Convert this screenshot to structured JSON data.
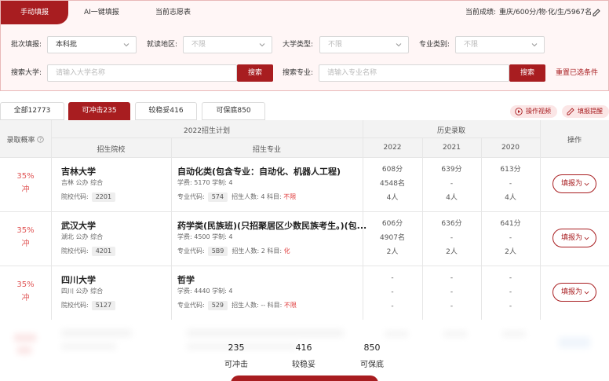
{
  "header": {
    "tabs": [
      "手动填报",
      "AI一键填报",
      "当前志愿表"
    ],
    "score_label": "当前成绩:",
    "score_value": "重庆/600分/物·化/生/5967名"
  },
  "filters": {
    "batch_label": "批次填报:",
    "batch_value": "本科批",
    "region_label": "就读地区:",
    "region_value": "不限",
    "type_label": "大学类型:",
    "type_value": "不限",
    "major_cat_label": "专业类别:",
    "major_cat_value": "不限",
    "search_uni_label": "搜索大学:",
    "search_uni_placeholder": "请输入大学名称",
    "search_btn": "搜索",
    "search_major_label": "搜索专业:",
    "search_major_placeholder": "请输入专业名称",
    "search_btn2": "搜索",
    "reset": "重置已选条件"
  },
  "category_tabs": [
    "全部12773",
    "可冲击235",
    "较稳妥416",
    "可保底850"
  ],
  "actions": {
    "video": "操作视频",
    "tips": "填报提醒"
  },
  "table_header": {
    "prob": "录取概率",
    "plan": "2022招生计划",
    "history": "历史录取",
    "action": "操作",
    "school": "招生院校",
    "major": "招生专业",
    "y2022": "2022",
    "y2021": "2021",
    "y2020": "2020"
  },
  "rows": [
    {
      "prob": "35%",
      "tag": "冲",
      "uni": "吉林大学",
      "uni_meta": "吉林  公办  综合",
      "code_label": "院校代码:",
      "code": "2201",
      "major": "自动化类(包含专业：自动化、机器人工程)",
      "fee": "学费: 5170  学制: 4",
      "mcode_label": "专业代码:",
      "mcode": "574",
      "plan": "招生人数: 4  科目:",
      "subject": "不限",
      "h2022": [
        "608分",
        "4548名",
        "4人"
      ],
      "h2021": [
        "639分",
        "-",
        "4人"
      ],
      "h2020": [
        "613分",
        "-",
        "4人"
      ],
      "btn": "填报为"
    },
    {
      "prob": "35%",
      "tag": "冲",
      "uni": "武汉大学",
      "uni_meta": "湖北  公办  综合",
      "code_label": "院校代码:",
      "code": "4201",
      "major": "药学类(民族班)(只招聚居区少数民族考生。)(包...",
      "fee": "学费: 4500  学制: 4",
      "mcode_label": "专业代码:",
      "mcode": "5B9",
      "plan": "招生人数: 2  科目:",
      "subject": "化",
      "h2022": [
        "606分",
        "4907名",
        "2人"
      ],
      "h2021": [
        "636分",
        "-",
        "2人"
      ],
      "h2020": [
        "641分",
        "-",
        "2人"
      ],
      "btn": "填报为"
    },
    {
      "prob": "35%",
      "tag": "冲",
      "uni": "四川大学",
      "uni_meta": "四川  公办  综合",
      "code_label": "院校代码:",
      "code": "5127",
      "major": "哲学",
      "fee": "学费: 4440  学制: 4",
      "mcode_label": "专业代码:",
      "mcode": "529",
      "plan": "招生人数: --  科目:",
      "subject": "不限",
      "h2022": [
        "-",
        "-",
        "-"
      ],
      "h2021": [
        "-",
        "-",
        "-"
      ],
      "h2020": [
        "-",
        "-",
        "-"
      ],
      "btn": "填报为"
    }
  ],
  "stats": [
    {
      "num": "235",
      "label": "可冲击"
    },
    {
      "num": "416",
      "label": "较稳妥"
    },
    {
      "num": "850",
      "label": "可保底"
    }
  ],
  "colors": {
    "accent": "#a81d20",
    "prob": "#e05555"
  }
}
